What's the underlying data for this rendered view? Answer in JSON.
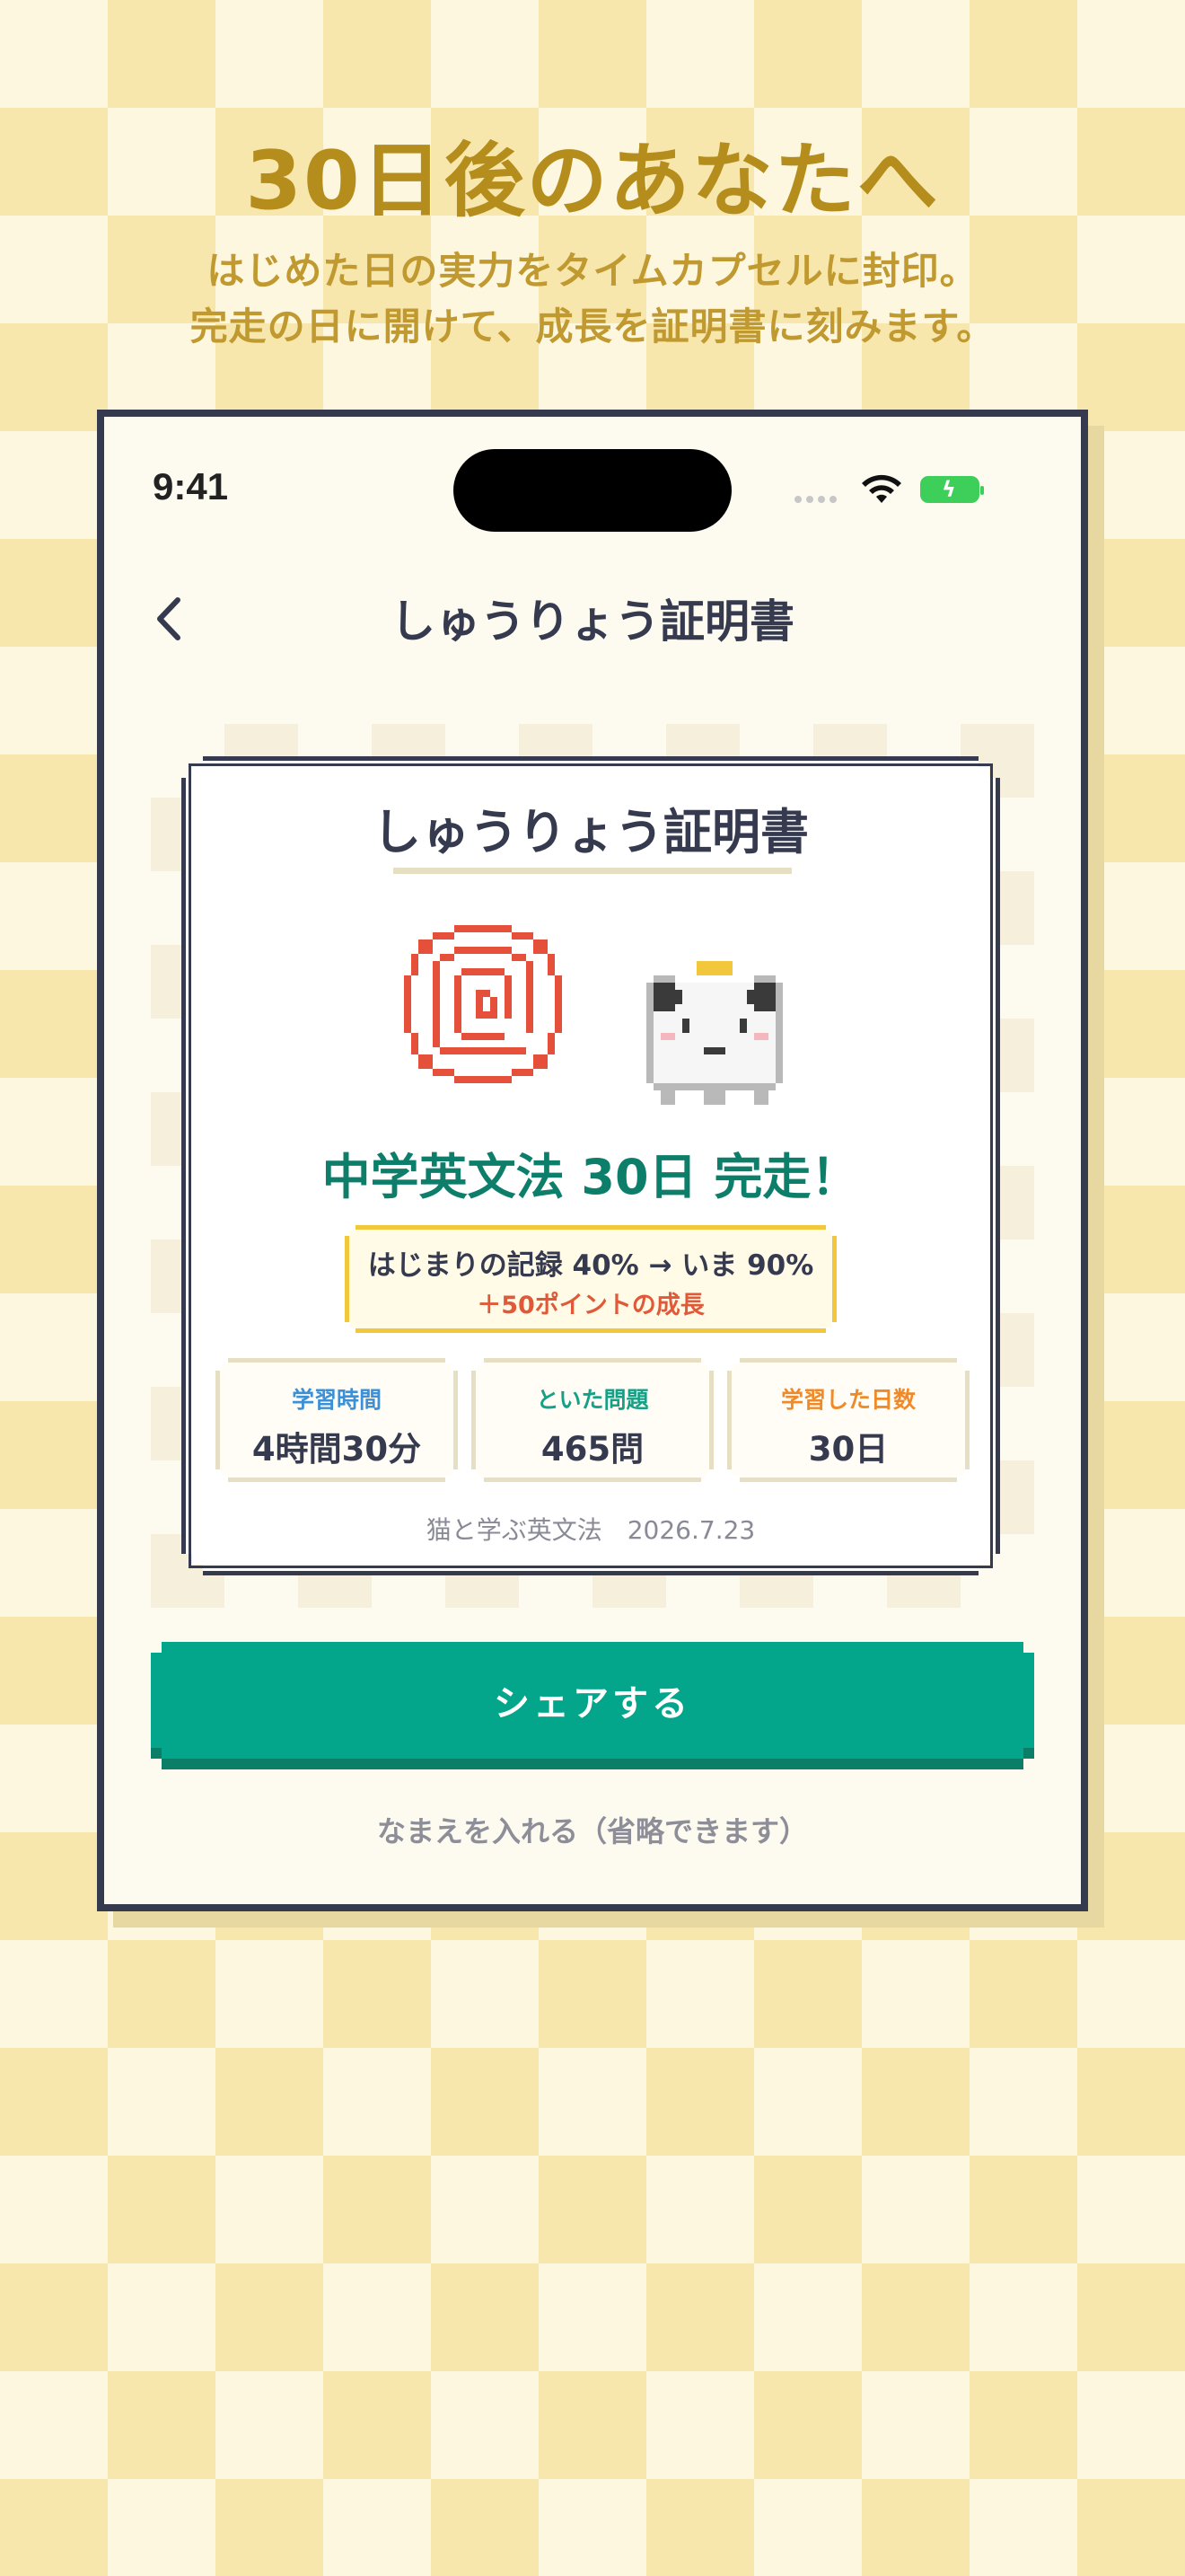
{
  "promo": {
    "headline": "30日後のあなたへ",
    "subline1": "はじめた日の実力をタイムカプセルに封印。",
    "subline2": "完走の日に開けて、成長を証明書に刻みます。"
  },
  "status_bar": {
    "time": "9:41"
  },
  "nav": {
    "back_icon": "chevron-left-icon",
    "title": "しゅうりょう証明書"
  },
  "certificate": {
    "title": "しゅうりょう証明書",
    "stamp_icon": "red-spiral-stamp-icon",
    "mascot_icon": "pixel-cat-with-crown-icon",
    "completion": "中学英文法 30日 完走！",
    "record_line1": "はじまりの記録 40% → いま 90%",
    "record_line2": "＋50ポイントの成長",
    "stats": [
      {
        "label": "学習時間",
        "value": "4時間30分",
        "color": "#3d8fd6"
      },
      {
        "label": "といた問題",
        "value": "465問",
        "color": "#16a085"
      },
      {
        "label": "学習した日数",
        "value": "30日",
        "color": "#ef8a2a"
      }
    ],
    "footer": "猫と学ぶ英文法　2026.7.23"
  },
  "actions": {
    "share_label": "シェアする",
    "name_link": "なまえを入れる（省略できます）"
  },
  "colors": {
    "accent_green": "#03a58b",
    "headline_gold": "#b58d1c",
    "frame_navy": "#363a4f"
  }
}
